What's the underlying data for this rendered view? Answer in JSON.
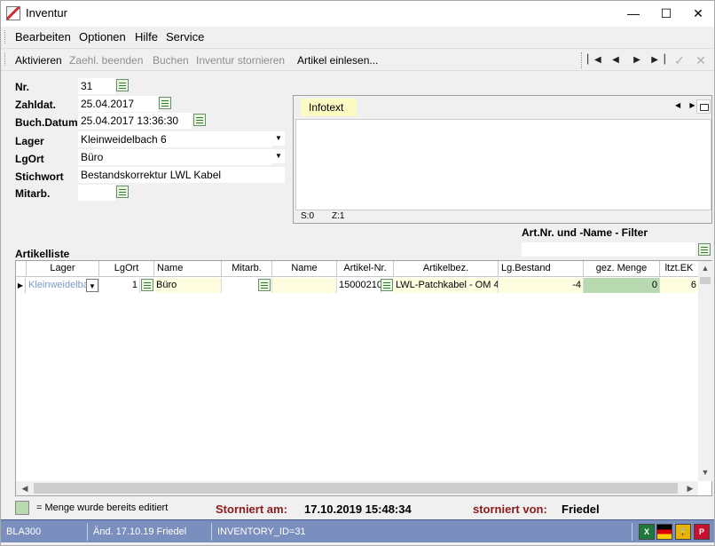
{
  "window": {
    "title": "Inventur"
  },
  "window_buttons": {
    "minimize": "—",
    "maximize": "☐",
    "close": "✕"
  },
  "menu": [
    "Bearbeiten",
    "Optionen",
    "Hilfe",
    "Service"
  ],
  "toolbar": {
    "items": [
      {
        "label": "Aktivieren",
        "enabled": true
      },
      {
        "label": "Zaehl. beenden",
        "enabled": false
      },
      {
        "label": "Buchen",
        "enabled": false
      },
      {
        "label": "Inventur stornieren",
        "enabled": false
      },
      {
        "label": "Artikel einlesen...",
        "enabled": true
      }
    ],
    "nav": {
      "first": "▏◀",
      "prev": "◀",
      "next": "▶",
      "last": "▶▕",
      "confirm": "✓",
      "cancel": "✕"
    }
  },
  "form": {
    "nr": {
      "label": "Nr.",
      "value": "31"
    },
    "zahldat": {
      "label": "Zahldat.",
      "value": "25.04.2017"
    },
    "buchdatum": {
      "label": "Buch.Datum",
      "value": "25.04.2017 13:36:30"
    },
    "lager": {
      "label": "Lager",
      "value": "Kleinweidelbach 6"
    },
    "lgort": {
      "label": "LgOrt",
      "value": "Büro"
    },
    "stichwort": {
      "label": "Stichwort",
      "value": "Bestandskorrektur LWL Kabel"
    },
    "mitarb": {
      "label": "Mitarb.",
      "value": ""
    }
  },
  "infopanel": {
    "tab": "Infotext",
    "arrows": "◀ ▶",
    "status_s": "S:0",
    "status_z": "Z:1"
  },
  "filter": {
    "label": "Art.Nr. und -Name - Filter",
    "value": ""
  },
  "grid": {
    "title": "Artikelliste",
    "columns": [
      "Lager",
      "LgOrt",
      "Name",
      "Mitarb.",
      "Name",
      "Artikel-Nr.",
      "Artikelbez.",
      "Lg.Bestand",
      "gez. Menge",
      "ltzt.EK"
    ],
    "rows": [
      {
        "lager": "Kleinweidelba",
        "lgort": "1",
        "lgort_name": "Büro",
        "mitarb": "",
        "mitarb_name": "",
        "artikel_nr": "15000210",
        "artikelbez": "LWL-Patchkabel - OM 4",
        "lg_bestand": "-4",
        "gez_menge": "0",
        "ltzt_ek": "6"
      }
    ]
  },
  "legend": {
    "text": "= Menge wurde bereits editiert",
    "color": "#b9d9b0"
  },
  "storno": {
    "am_label": "Storniert am:",
    "am_value": "17.10.2019 15:48:34",
    "von_label": "storniert von:",
    "von_value": "Friedel"
  },
  "statusbar": {
    "module": "BLA300",
    "changed": "Änd. 17.10.19 Friedel",
    "record": "INVENTORY_ID=31"
  },
  "colors": {
    "statusbar_bg": "#7b8fbf",
    "storno_label": "#8b1a1a",
    "edited_cell": "#b9d9b0",
    "editable_cell": "#fffde0",
    "tab_bg": "#fdfac4"
  }
}
